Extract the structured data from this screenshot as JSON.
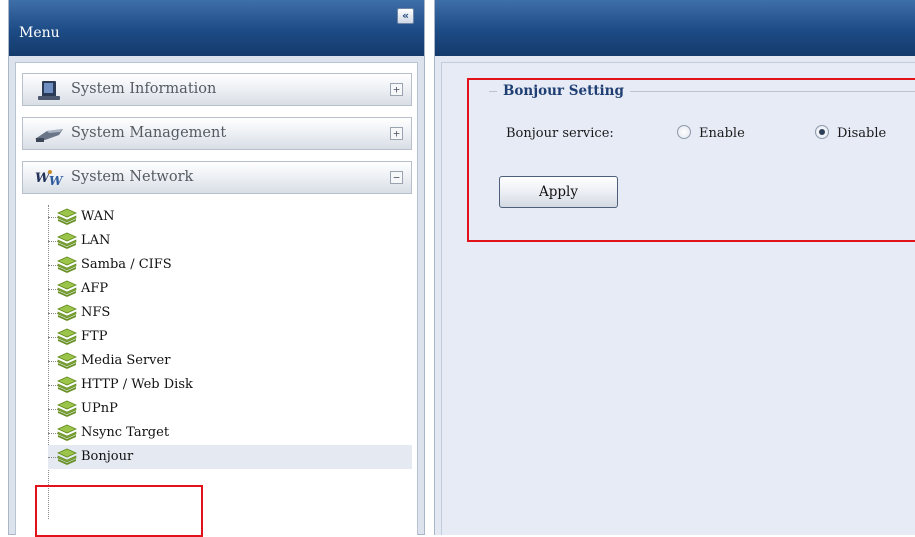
{
  "menu": {
    "title": "Menu",
    "collapse_glyph": "«",
    "sections": [
      {
        "label": "System Information",
        "toggle": "+",
        "icon": "monitor-icon"
      },
      {
        "label": "System Management",
        "toggle": "+",
        "icon": "tools-icon"
      },
      {
        "label": "System Network",
        "toggle": "−",
        "icon": "network-icon"
      }
    ],
    "network_items": [
      {
        "label": "WAN"
      },
      {
        "label": "LAN"
      },
      {
        "label": "Samba / CIFS"
      },
      {
        "label": "AFP"
      },
      {
        "label": "NFS"
      },
      {
        "label": "FTP"
      },
      {
        "label": "Media Server"
      },
      {
        "label": "HTTP / Web Disk"
      },
      {
        "label": "UPnP"
      },
      {
        "label": "Nsync Target"
      },
      {
        "label": "Bonjour",
        "selected": true
      }
    ]
  },
  "content": {
    "legend": "Bonjour Setting",
    "service_label": "Bonjour service:",
    "options": [
      {
        "label": "Enable",
        "checked": false
      },
      {
        "label": "Disable",
        "checked": true
      }
    ],
    "apply_label": "Apply"
  },
  "colors": {
    "header_blue": "#1d4b85",
    "highlight_red": "#e2121a",
    "legend_text": "#1f3f73",
    "leaf_icon_green": "#8bb33a"
  }
}
